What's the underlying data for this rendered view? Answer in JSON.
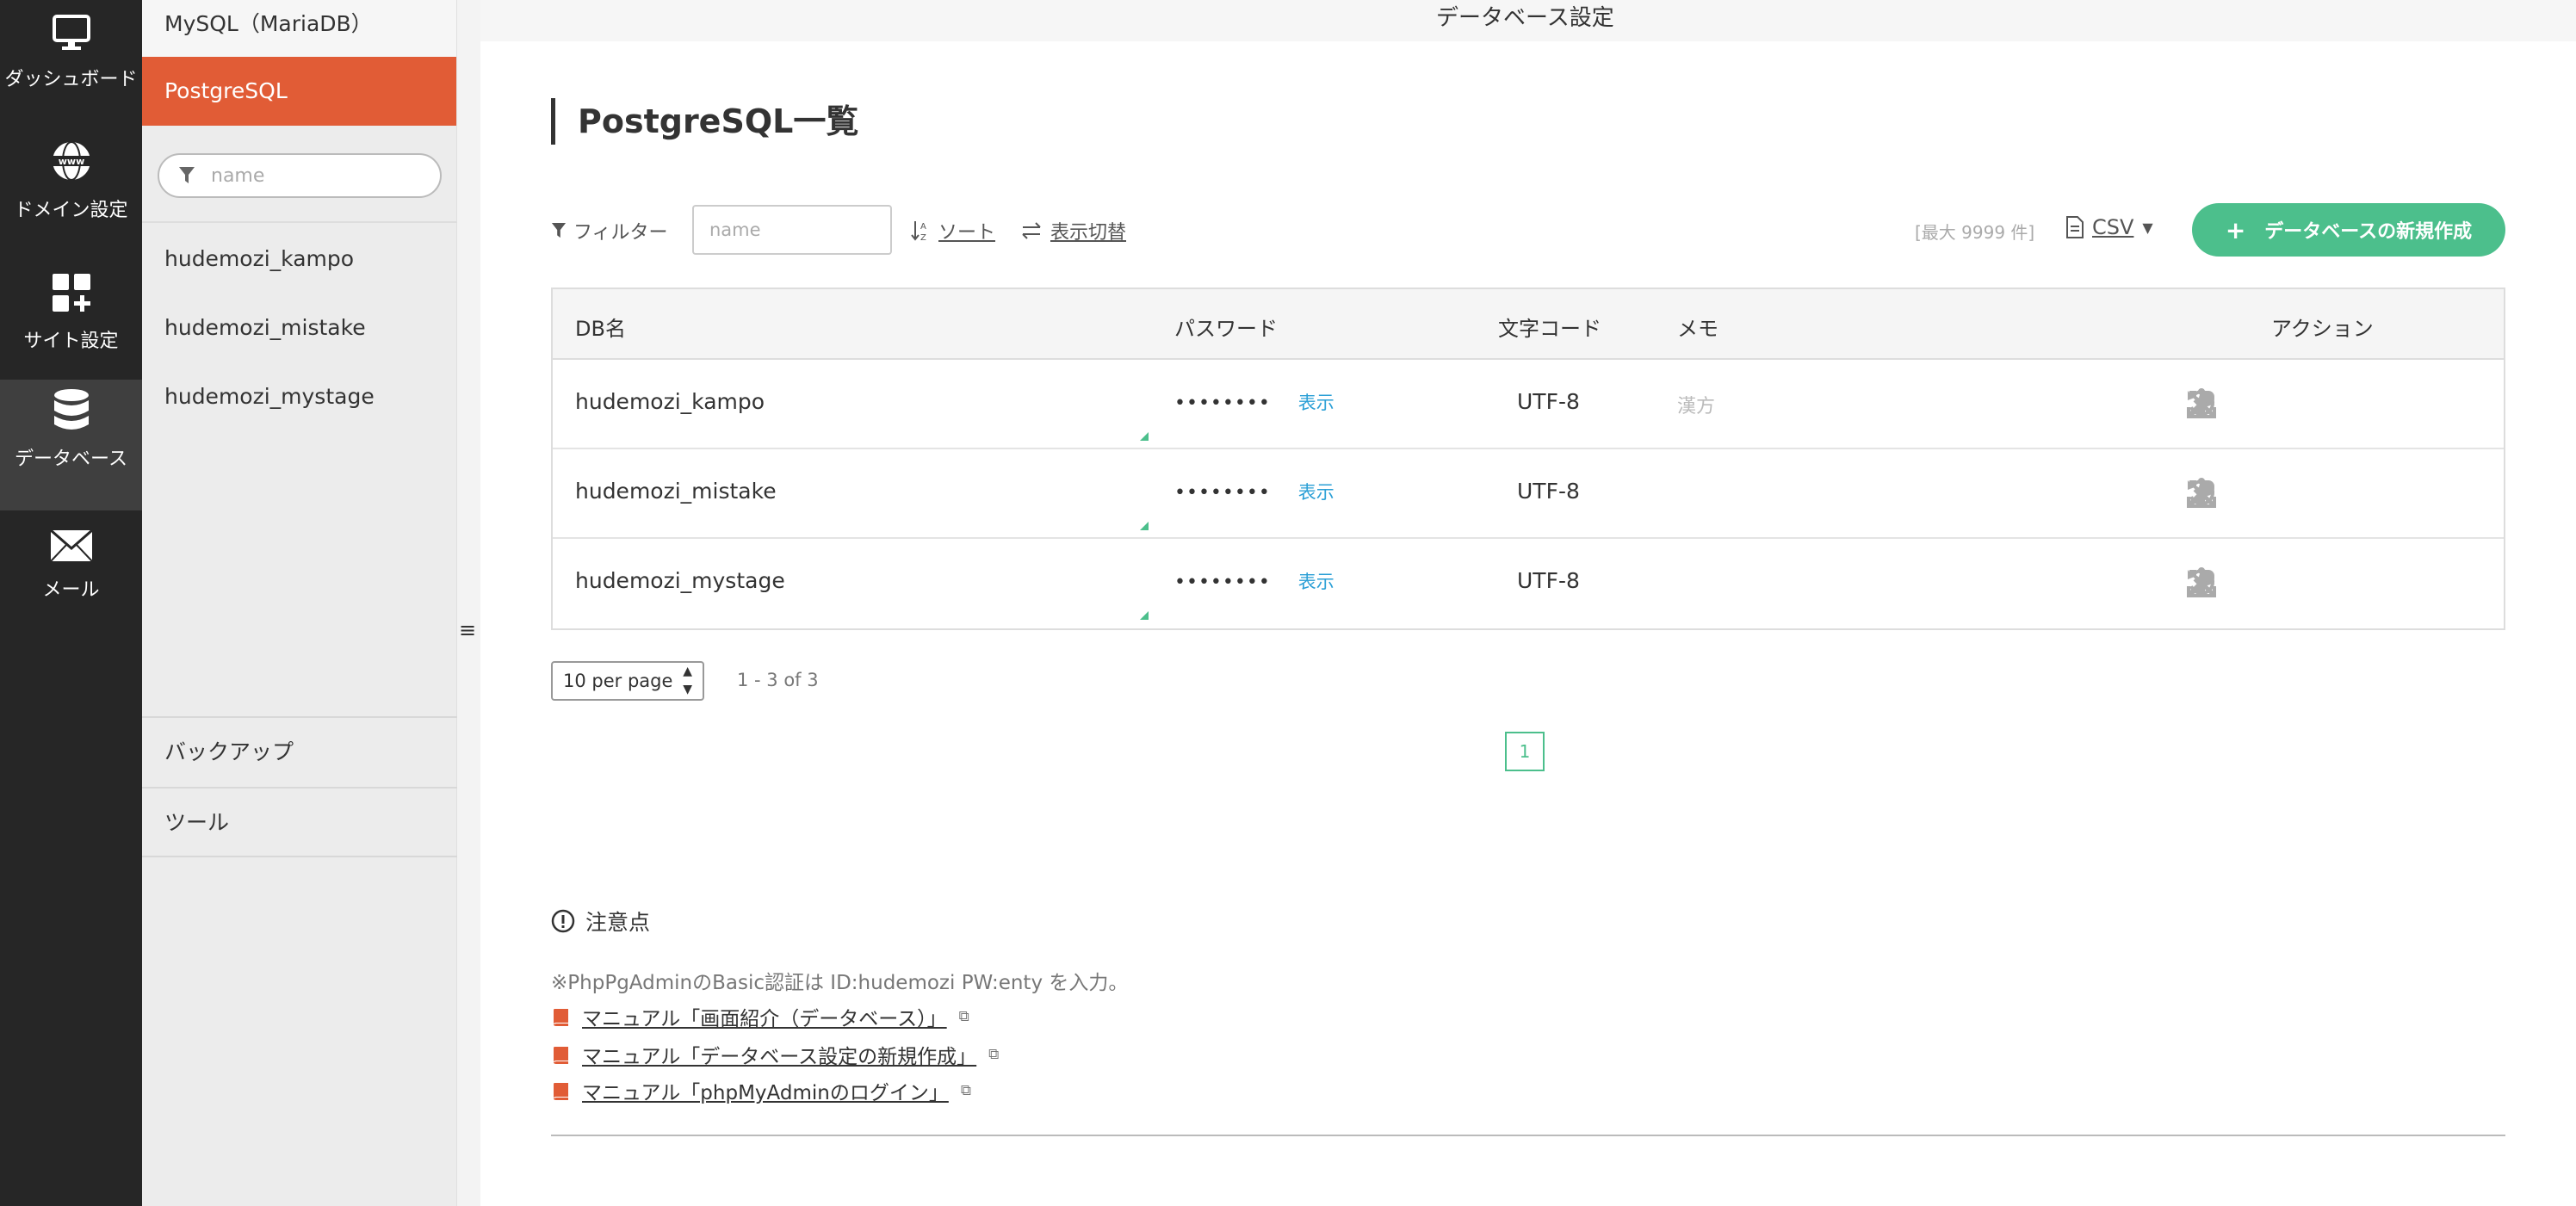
{
  "rail": [
    {
      "label": "ダッシュボード",
      "icon": "monitor-icon"
    },
    {
      "label": "ドメイン設定",
      "icon": "globe-www-icon"
    },
    {
      "label": "サイト設定",
      "icon": "grid-plus-icon"
    },
    {
      "label": "データベース",
      "icon": "database-icon",
      "active": true
    },
    {
      "label": "メール",
      "icon": "envelope-icon"
    }
  ],
  "sidebar": {
    "mysql": "MySQL（MariaDB）",
    "postgres": "PostgreSQL",
    "filter_placeholder": "name",
    "databases": [
      "hudemozi_kampo",
      "hudemozi_mistake",
      "hudemozi_mystage"
    ],
    "backup": "バックアップ",
    "tools": "ツール"
  },
  "header": {
    "title": "データベース設定"
  },
  "page": {
    "title": "PostgreSQL一覧"
  },
  "toolbar": {
    "filter_label": "フィルター",
    "filter_placeholder": "name",
    "sort_label": "ソート",
    "view_label": "表示切替",
    "max_label": "[最大 9999 件]",
    "csv_label": "CSV",
    "new_button": "データベースの新規作成"
  },
  "table": {
    "headers": {
      "name": "DB名",
      "password": "パスワード",
      "encoding": "文字コード",
      "memo": "メモ",
      "action": "アクション"
    },
    "rows": [
      {
        "name": "hudemozi_kampo",
        "password": "••••••••",
        "show": "表示",
        "encoding": "UTF-8",
        "memo": "漢方"
      },
      {
        "name": "hudemozi_mistake",
        "password": "••••••••",
        "show": "表示",
        "encoding": "UTF-8",
        "memo": ""
      },
      {
        "name": "hudemozi_mystage",
        "password": "••••••••",
        "show": "表示",
        "encoding": "UTF-8",
        "memo": ""
      }
    ]
  },
  "pagination": {
    "per_page": "10 per page",
    "range": "1 - 3 of 3",
    "current": "1"
  },
  "notes": {
    "title": "注意点",
    "text": "※PhpPgAdminのBasic認証は ID:hudemozi PW:enty を入力。",
    "manuals": [
      "マニュアル「画面紹介（データベース）」",
      "マニュアル「データベース設定の新規作成」",
      "マニュアル「phpMyAdminのログイン」"
    ]
  },
  "colors": {
    "accent": "#e15c36",
    "primary": "#4cbf8c",
    "link": "#2a9fd6",
    "rail": "#262626"
  }
}
